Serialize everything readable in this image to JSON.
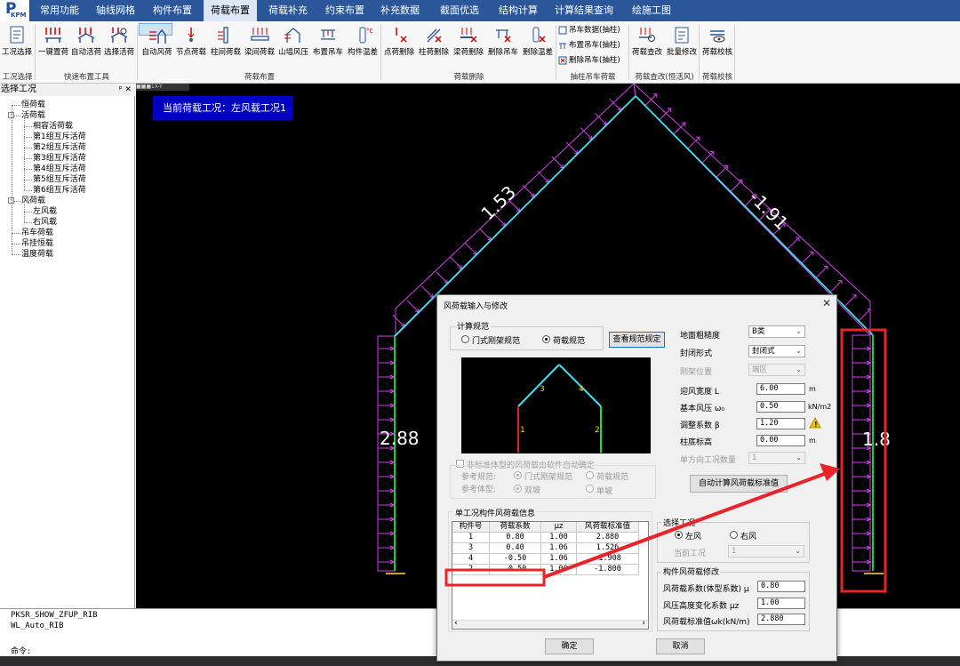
{
  "logo": {
    "letter": "P",
    "sub": "KPM"
  },
  "menu": [
    "常用功能",
    "轴线网格",
    "构件布置",
    "荷载布置",
    "荷载补充",
    "约束布置",
    "补充数据",
    "截面优选",
    "结构计算",
    "计算结果查询",
    "绘施工图"
  ],
  "menu_active_index": 3,
  "ribbon": {
    "buttons": [
      "工况选择",
      "一键置荷",
      "自动活荷",
      "选择活荷",
      "自动风荷",
      "节点荷载",
      "柱间荷载",
      "梁间荷载",
      "山墙风压",
      "布置吊车",
      "构件温差",
      "点荷删除",
      "柱荷删除",
      "梁荷删除",
      "删除吊车",
      "删除温差",
      "荷载查改",
      "批量修改",
      "荷载校核"
    ],
    "small_buttons": [
      "吊车数据(抽柱)",
      "布置吊车(抽柱)",
      "删除吊车(抽柱)"
    ],
    "groups": [
      "工况选择",
      "快速布置工具",
      "荷载布置",
      "荷载删除",
      "抽柱吊车荷载",
      "荷载查改(恒活风)",
      "荷载校核"
    ]
  },
  "left_panel": {
    "title": "选择工况",
    "pin": "ᵖ ✕",
    "tree": [
      {
        "label": "恒荷载",
        "level": 0
      },
      {
        "label": "活荷载",
        "level": 0,
        "expander": "-"
      },
      {
        "label": "相容活荷载",
        "level": 1
      },
      {
        "label": "第1组互斥活荷",
        "level": 1
      },
      {
        "label": "第2组互斥活荷",
        "level": 1
      },
      {
        "label": "第3组互斥活荷",
        "level": 1
      },
      {
        "label": "第4组互斥活荷",
        "level": 1
      },
      {
        "label": "第5组互斥活荷",
        "level": 1
      },
      {
        "label": "第6组互斥活荷",
        "level": 1
      },
      {
        "label": "风荷载",
        "level": 0,
        "expander": "-"
      },
      {
        "label": "左风载",
        "level": 1
      },
      {
        "label": "右风载",
        "level": 1
      },
      {
        "label": "吊车荷载",
        "level": 0
      },
      {
        "label": "吊挂恒载",
        "level": 0
      },
      {
        "label": "温度荷载",
        "level": 0
      }
    ]
  },
  "canvas": {
    "tab": "■■■1X-Y",
    "current_case": "当前荷载工况：左风载工况1",
    "load_labels": {
      "left_column": "2.88",
      "left_rafter": "1.53",
      "right_rafter": "-1.91",
      "right_column": "1.8"
    }
  },
  "command": {
    "line1": "PKSR_SHOW_ZFUP_RIB",
    "line2": "WL_Auto_RIB",
    "prompt": "命令:"
  },
  "dialog": {
    "title": "风荷载输入与修改",
    "close": "✕",
    "spec_group": "计算规范",
    "spec_options": [
      "门式刚架规范",
      "荷载规范"
    ],
    "spec_selected": 1,
    "view_spec_button": "查看规范规定",
    "preview_labels": [
      "1",
      "2",
      "3",
      "4"
    ],
    "nonstd_check": "非标准体型的风荷载由软件自动确定",
    "ref_spec_label": "参考规范:",
    "ref_spec_options": [
      "门式刚架规范",
      "荷载规范"
    ],
    "ref_shape_label": "参考体型:",
    "ref_shape_options": [
      "双坡",
      "单坡"
    ],
    "params": {
      "roughness_label": "地面粗糙度",
      "roughness_value": "B类",
      "enclosure_label": "封闭形式",
      "enclosure_value": "封闭式",
      "frame_pos_label": "刚架位置",
      "frame_pos_value": "端区",
      "width_label": "迎风宽度 L",
      "width_value": "6.00",
      "width_unit": "m",
      "pressure_label": "基本风压 ω₀",
      "pressure_value": "0.50",
      "pressure_unit": "kN/m2",
      "adjust_label": "调整系数 β",
      "adjust_value": "1.20",
      "base_label": "柱底标高",
      "base_value": "0.00",
      "base_unit": "m",
      "cases_label": "单方向工况数量",
      "cases_value": "1"
    },
    "auto_calc_button": "自动计算风荷载标准值",
    "table_group": "单工况构件风荷载信息",
    "table_headers": [
      "构件号",
      "荷载系数",
      "μz",
      "风荷载标准值"
    ],
    "table_rows": [
      [
        "1",
        "0.80",
        "1.00",
        "2.880"
      ],
      [
        "3",
        "0.40",
        "1.06",
        "1.526"
      ],
      [
        "4",
        "-0.50",
        "1.06",
        "-1.908"
      ],
      [
        "2",
        "-0.50",
        "1.00",
        "-1.800"
      ]
    ],
    "select_case_group": "选择工况",
    "wind_dir_options": [
      "左风",
      "右风"
    ],
    "wind_dir_selected": 0,
    "current_case_label": "当前工况",
    "current_case_value": "1",
    "modify_group": "构件风荷载修改",
    "coef_label": "风荷载系数(体型系数) μ",
    "coef_value": "0.80",
    "height_label": "风压高度变化系数 μz",
    "height_value": "1.00",
    "std_label": "风荷载标准值ωk(kN/m)",
    "std_value": "2.880",
    "ok_button": "确定",
    "cancel_button": "取消"
  },
  "colors": {
    "accent": "#2b579a",
    "highlight_red": "#e8242a",
    "load_magenta": "#d040e8",
    "member_cyan": "#40e0f0",
    "column_green": "#20e040"
  }
}
